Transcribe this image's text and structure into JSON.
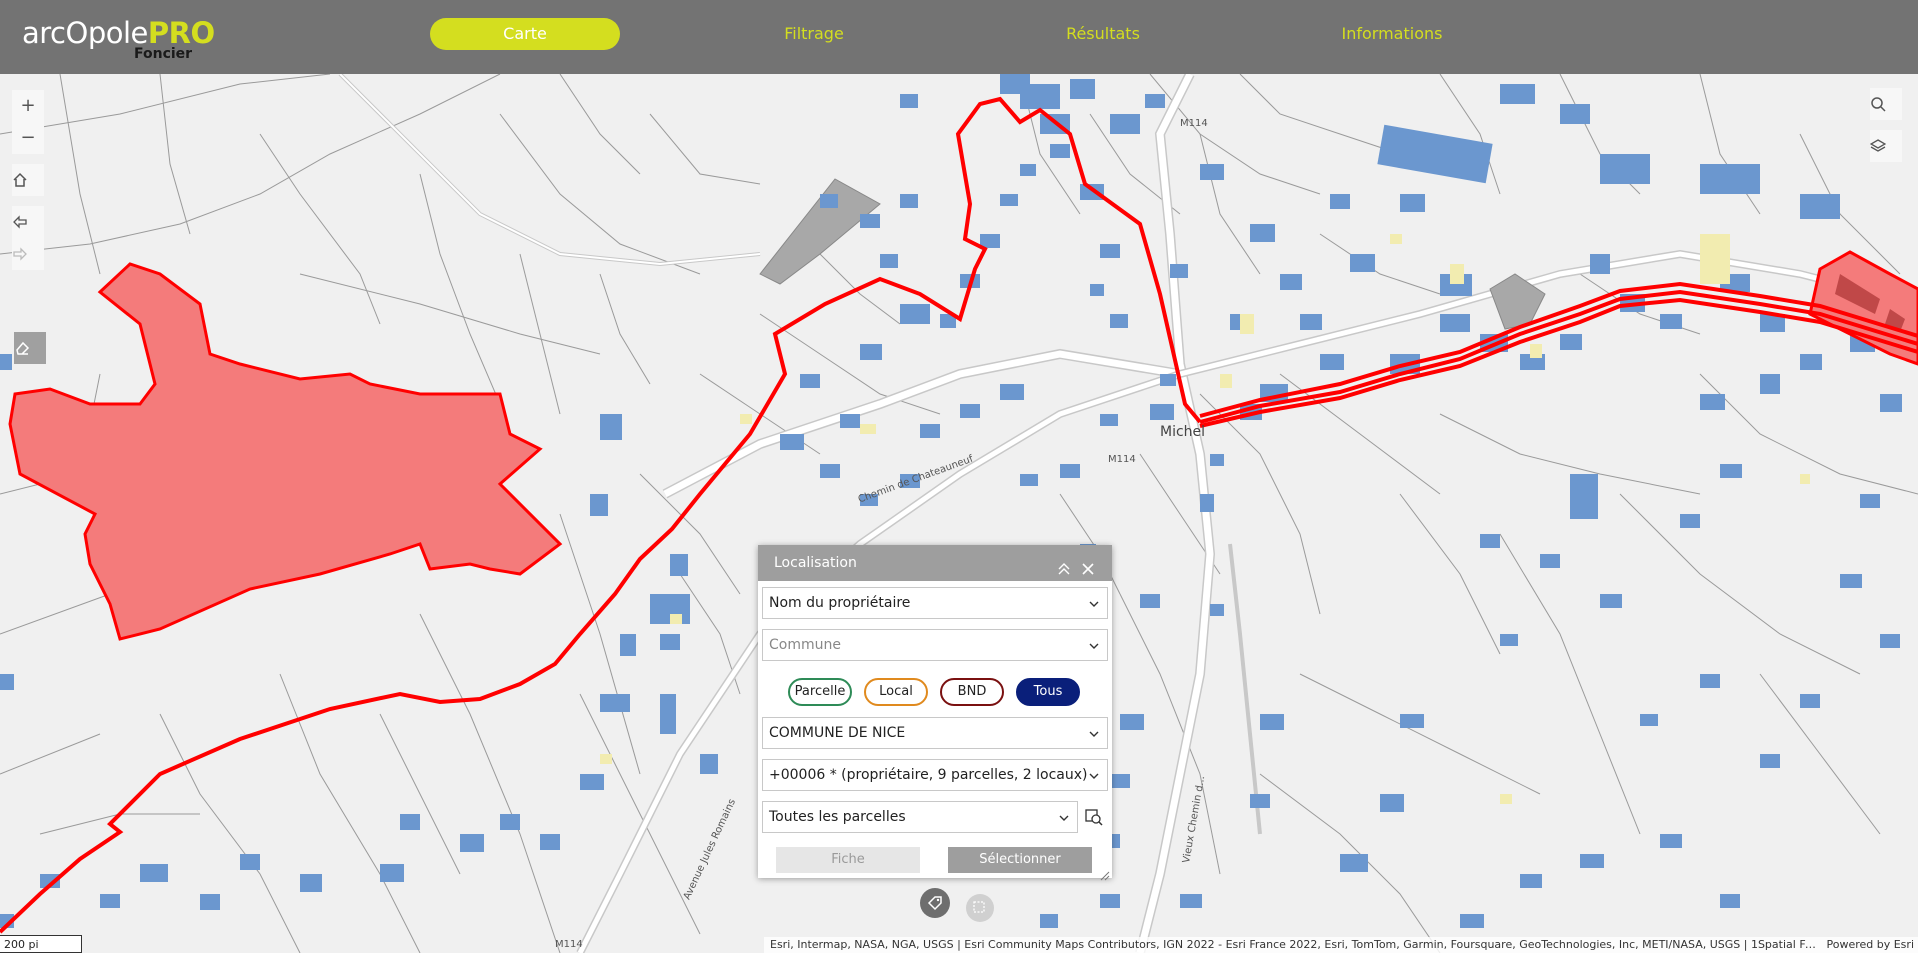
{
  "app": {
    "logo_main": "arcOpole",
    "logo_pro": "PRO",
    "logo_sub": "Foncier"
  },
  "nav": {
    "tabs": [
      {
        "label": "Carte",
        "active": true
      },
      {
        "label": "Filtrage",
        "active": false
      },
      {
        "label": "Résultats",
        "active": false
      },
      {
        "label": "Informations",
        "active": false
      }
    ]
  },
  "map_controls": {
    "zoom_in": "+",
    "zoom_out": "−",
    "icons": [
      "home-icon",
      "previous-extent-icon",
      "next-extent-icon",
      "eraser-icon",
      "search-icon",
      "layers-icon"
    ]
  },
  "map": {
    "place_label": "Michel",
    "road_labels": {
      "chateauneuf": "Chemin de Chateauneuf",
      "m114_a": "M114",
      "m114_b": "M114",
      "m114_c": "M114",
      "jules_romains": "Avenue Jules Romains",
      "vieux_chemin": "Vieux Chemin d..."
    },
    "scale": "200 pi",
    "attribution": "Esri, Intermap, NASA, NGA, USGS | Esri Community Maps Contributors, IGN 2022 - Esri France 2022, Esri, TomTom, Garmin, Foursquare, GeoTechnologies, Inc, METI/NASA, USGS | 1Spatial Fra...",
    "powered_by": "Powered by Esri",
    "colors": {
      "parcel_fill": "#f47b7b",
      "parcel_outline": "#ff0000",
      "building": "#6b97cf",
      "background": "#f0f0f0"
    }
  },
  "panel": {
    "title": "Localisation",
    "owner_select": "Nom du propriétaire",
    "commune_placeholder": "Commune",
    "filters": [
      {
        "label": "Parcelle",
        "color": "#2e8b57",
        "active": false
      },
      {
        "label": "Local",
        "color": "#e08a1e",
        "active": false
      },
      {
        "label": "BND",
        "color": "#7a1010",
        "active": false
      },
      {
        "label": "Tous",
        "color": "#0a1f7a",
        "active": true
      }
    ],
    "commune_value": "COMMUNE DE NICE",
    "owner_value": "+00006 * (propriétaire, 9 parcelles, 2 locaux)",
    "parcels_value": "Toutes les parcelles",
    "fiche_label": "Fiche",
    "select_label": "Sélectionner"
  }
}
